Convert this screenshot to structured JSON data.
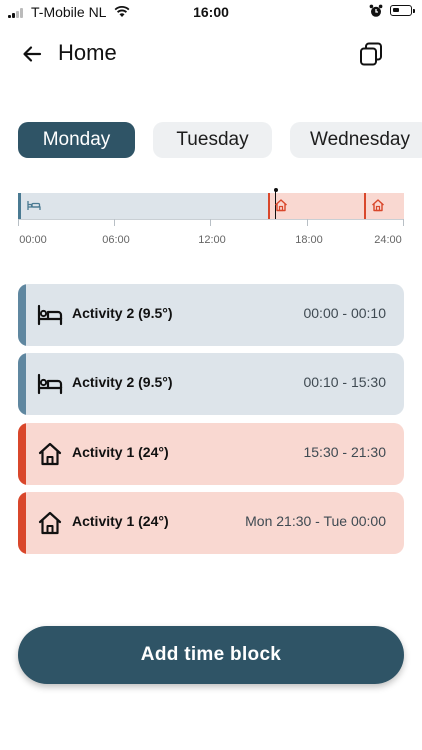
{
  "status_bar": {
    "carrier": "T-Mobile NL",
    "time": "16:00",
    "battery_level": 0.3
  },
  "header": {
    "title": "Home",
    "back_icon": "arrow-left-icon",
    "copy_icon": "copy-icon"
  },
  "day_tabs": [
    {
      "label": "Monday",
      "selected": true
    },
    {
      "label": "Tuesday",
      "selected": false
    },
    {
      "label": "Wednesday",
      "selected": false
    }
  ],
  "timeline": {
    "axis_labels": [
      "00:00",
      "06:00",
      "12:00",
      "18:00",
      "24:00"
    ],
    "current_time": "16:00",
    "segments": [
      {
        "start": "00:00",
        "end": "00:10",
        "type": "sleep"
      },
      {
        "start": "00:10",
        "end": "15:30",
        "type": "sleep"
      },
      {
        "start": "15:30",
        "end": "21:30",
        "type": "home"
      },
      {
        "start": "21:30",
        "end": "24:00",
        "type": "home"
      }
    ]
  },
  "blocks": [
    {
      "name": "Activity 2 (9.5°)",
      "time": "00:00 - 00:10",
      "type": "sleep",
      "icon": "bed-icon"
    },
    {
      "name": "Activity 2 (9.5°)",
      "time": "00:10 - 15:30",
      "type": "sleep",
      "icon": "bed-icon"
    },
    {
      "name": "Activity 1 (24°)",
      "time": "15:30 - 21:30",
      "type": "home",
      "icon": "house-icon"
    },
    {
      "name": "Activity 1 (24°)",
      "time": "Mon 21:30 - Tue 00:00",
      "type": "home",
      "icon": "house-icon"
    }
  ],
  "add_button": {
    "label": "Add time block"
  },
  "colors": {
    "primary": "#2f5466",
    "sleep_bg": "#dde4ea",
    "sleep_accent": "#5f87a0",
    "home_bg": "#f9d8d1",
    "home_accent": "#d9472b"
  }
}
